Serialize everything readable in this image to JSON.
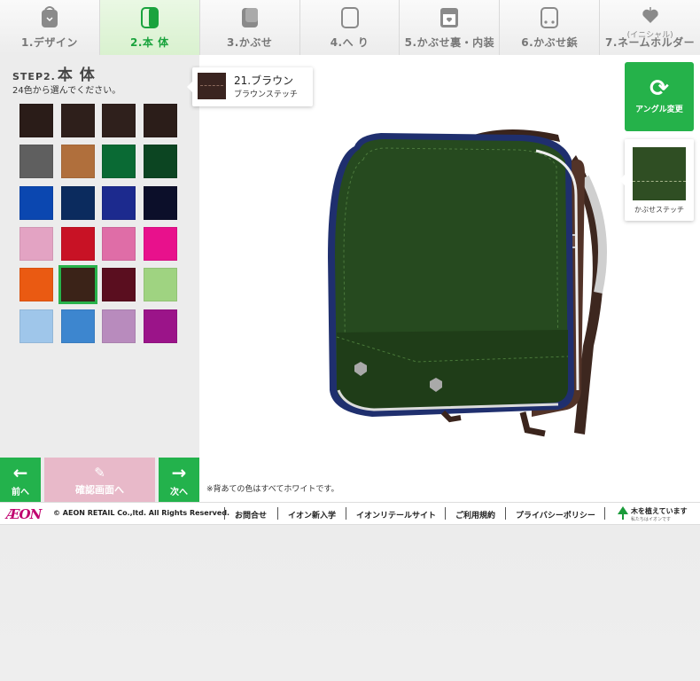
{
  "steps": [
    {
      "label": "1.デザイン",
      "icon": "bag-design-icon",
      "active": false
    },
    {
      "label": "2.本 体",
      "icon": "bag-body-icon",
      "active": true
    },
    {
      "label": "3.かぶせ",
      "icon": "bag-flap-icon",
      "active": false
    },
    {
      "label": "4.へ り",
      "icon": "bag-edge-icon",
      "active": false
    },
    {
      "label": "5.かぶせ裏・内装",
      "icon": "bag-inner-icon",
      "active": false
    },
    {
      "label": "6.かぶせ鋲",
      "icon": "bag-rivet-icon",
      "active": false
    },
    {
      "label": "7.ネームホルダー",
      "sub": "(イニシャル)",
      "icon": "heart-tag-icon",
      "active": false
    }
  ],
  "panel": {
    "step_prefix": "STEP2.",
    "step_title": "本 体",
    "subtitle": "24色から選んでください。"
  },
  "swatches": [
    "#2a1c18",
    "#2e1f1b",
    "#2f201c",
    "#2b1d19",
    "#5f5f5f",
    "#b06f3c",
    "#0a6a34",
    "#0c4522",
    "#0b47b0",
    "#0b2b5e",
    "#1c2a8e",
    "#0c0f2a",
    "#e3a3c3",
    "#c81225",
    "#df6da7",
    "#e8118c",
    "#ea5a12",
    "#3b2318",
    "#5a0e1f",
    "#9fd381",
    "#9fc6ea",
    "#3d86cf",
    "#b88bbd",
    "#9b1489"
  ],
  "selected_index": 17,
  "selected_color": {
    "name": "21.ブラウン",
    "stitch": "ブラウンステッチ"
  },
  "nav": {
    "prev": "前へ",
    "confirm": "確認画面へ",
    "next": "次へ"
  },
  "angle_button": "アングル変更",
  "stitch_card_label": "かぶせステッチ",
  "note": "※背あての色はすべてホワイトです。",
  "footer": {
    "logo": "ÆON",
    "copyright": "© AEON RETAIL Co.,ltd. All Rights Reserved.",
    "links": [
      "お問合せ",
      "イオン新入学",
      "イオンリテールサイト",
      "ご利用規約",
      "プライバシーポリシー"
    ],
    "tree_text": "木を植えています",
    "tree_sub": "私たちはイオンです"
  },
  "colors": {
    "accent_green": "#23b24c",
    "bag_body": "#244a1e",
    "bag_side": "#4b2e24",
    "bag_trim": "#1e2d6e"
  }
}
